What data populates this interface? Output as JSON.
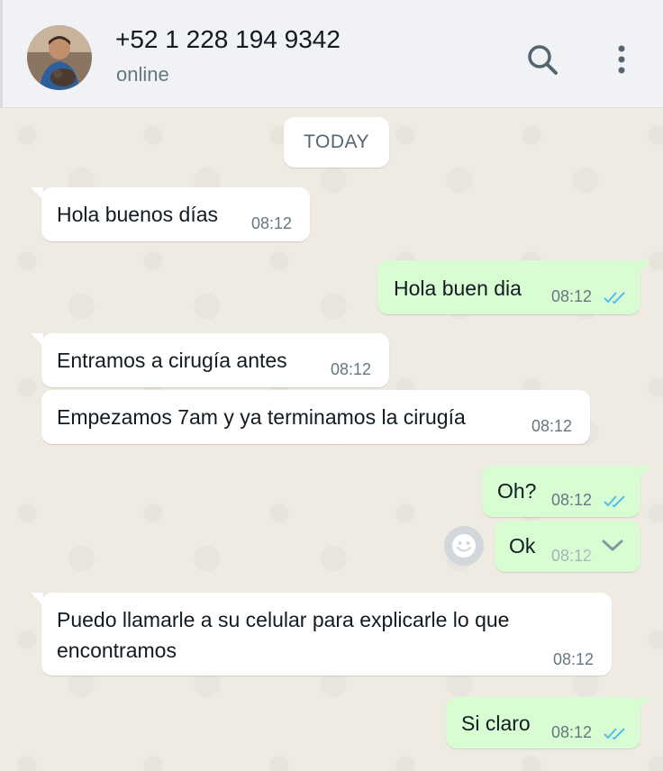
{
  "header": {
    "contact_name": "+52 1 228 194 9342",
    "status": "online",
    "icons": {
      "search": "search-icon",
      "menu": "more-vertical-icon",
      "avatar": "contact-avatar"
    }
  },
  "chat": {
    "date_chip": "TODAY",
    "colors": {
      "incoming": "#ffffff",
      "outgoing": "#d9fdd3",
      "read_ticks": "#53bdeb"
    },
    "messages": [
      {
        "direction": "in",
        "text": "Hola buenos días",
        "time": "08:12"
      },
      {
        "direction": "out",
        "text": "Hola buen dia",
        "time": "08:12",
        "status": "read"
      },
      {
        "direction": "in",
        "text": "Entramos a cirugía antes",
        "time": "08:12"
      },
      {
        "direction": "in",
        "text": "Empezamos 7am y ya terminamos la cirugía",
        "time": "08:12"
      },
      {
        "direction": "out",
        "text": "Oh?",
        "time": "08:12",
        "status": "read"
      },
      {
        "direction": "out",
        "text": "Ok",
        "time": "08:12",
        "status": "hover-menu"
      },
      {
        "direction": "in",
        "text_line1": "Puedo llamarle a su celular para explicarle lo que",
        "text_line2": "encontramos",
        "time": "08:12"
      },
      {
        "direction": "out",
        "text": "Si claro",
        "time": "08:12",
        "status": "read"
      }
    ]
  }
}
